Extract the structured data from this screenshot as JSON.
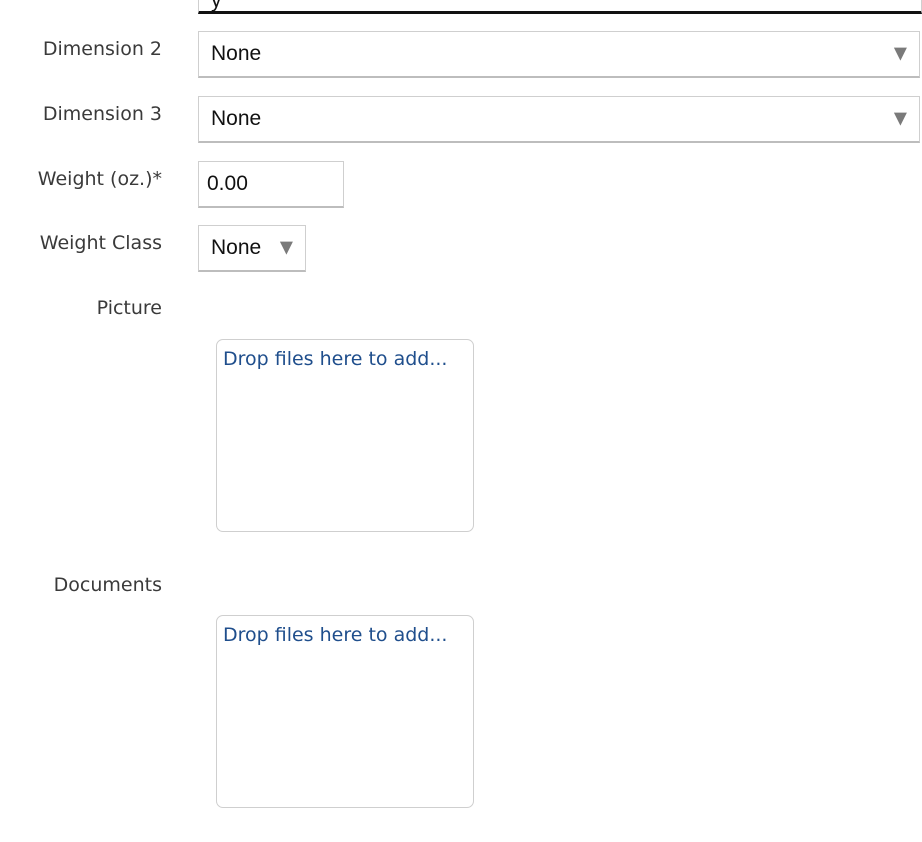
{
  "form": {
    "top_field": {
      "value": "y"
    },
    "dimension2": {
      "label": "Dimension 2",
      "value": "None",
      "caret": "▼"
    },
    "dimension3": {
      "label": "Dimension 3",
      "value": "None",
      "caret": "▼"
    },
    "weight": {
      "label": "Weight (oz.)*",
      "value": "0.00"
    },
    "weight_class": {
      "label": "Weight Class",
      "value": "None",
      "caret": "▼"
    },
    "picture": {
      "label": "Picture",
      "dropzone_text": "Drop files here to add..."
    },
    "documents": {
      "label": "Documents",
      "dropzone_text": "Drop files here to add..."
    }
  },
  "icons": {
    "dropdown_caret": "chevron-down-icon"
  },
  "colors": {
    "label_text": "#3a3a3a",
    "field_text": "#111111",
    "dropzone_link": "#1f4e8c",
    "field_border": "#cfcfcf",
    "caret": "#7a7a7a"
  }
}
